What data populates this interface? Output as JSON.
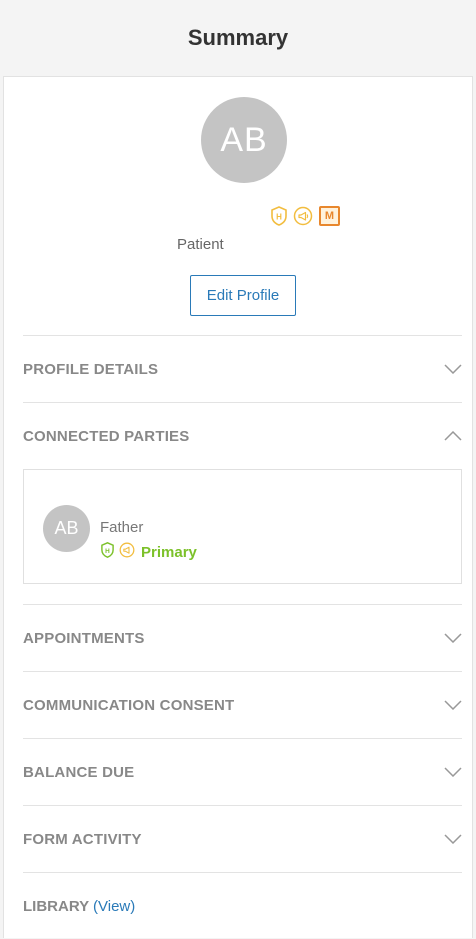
{
  "header": {
    "title": "Summary"
  },
  "profile": {
    "initials": "AB",
    "role": "Patient",
    "badge_m": "M",
    "edit_label": "Edit Profile"
  },
  "sections": {
    "profile_details": "PROFILE DETAILS",
    "connected_parties": "CONNECTED PARTIES",
    "appointments": "APPOINTMENTS",
    "communication_consent": "COMMUNICATION CONSENT",
    "balance_due": "BALANCE DUE",
    "form_activity": "FORM ACTIVITY",
    "library": "LIBRARY",
    "library_paren_open": "(",
    "library_link": "View",
    "library_paren_close": ")"
  },
  "connected_party": {
    "initials": "AB",
    "relation": "Father",
    "status": "Primary"
  },
  "icons": {
    "chevron_down": "chevron-down-icon",
    "chevron_up": "chevron-up-icon",
    "hipaa": "hipaa-shield-icon",
    "megaphone": "megaphone-icon"
  },
  "colors": {
    "accent": "#2a7ab8",
    "badge_orange": "#e8872d",
    "badge_yellow": "#f2bd3f",
    "badge_green": "#7cc12a",
    "avatar": "#c4c4c4"
  }
}
